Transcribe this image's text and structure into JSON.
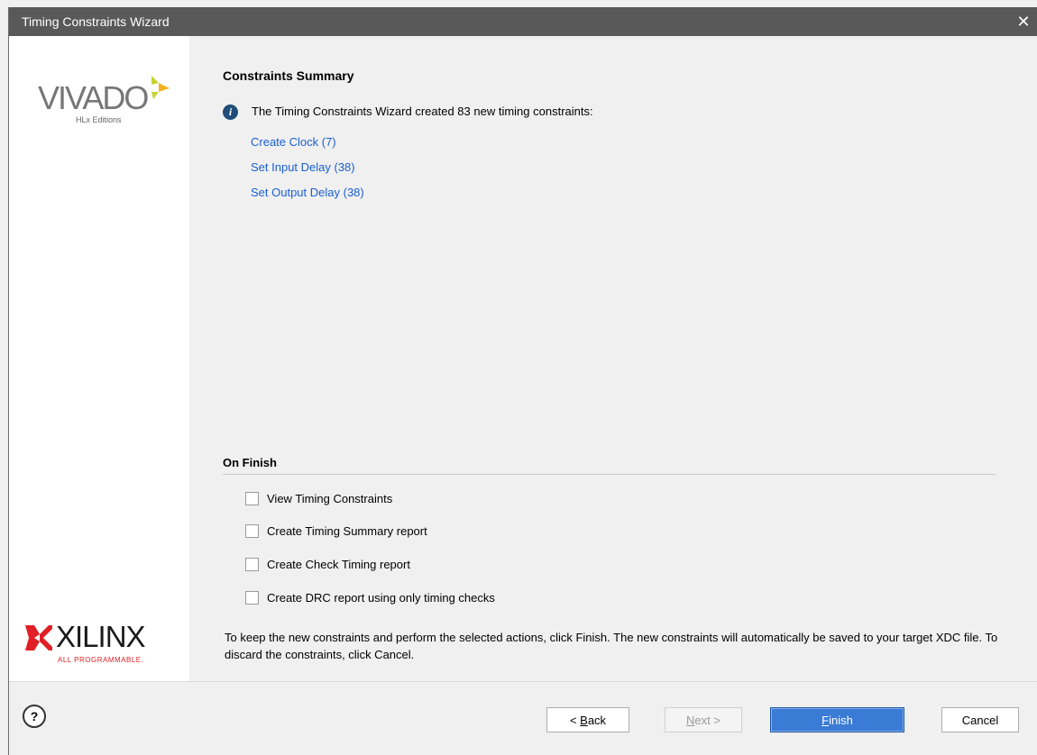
{
  "window": {
    "title": "Timing Constraints Wizard",
    "close_glyph": "✕"
  },
  "sidebar": {
    "vivado_logo": {
      "word": "VIVADO",
      "sub": "HLx Editions"
    },
    "xilinx_logo": {
      "word": "XILINX",
      "sub": "ALL PROGRAMMABLE."
    }
  },
  "main": {
    "heading": "Constraints Summary",
    "info_text": "The Timing Constraints Wizard created 83 new timing constraints:",
    "links": [
      {
        "label": "Create Clock (7)"
      },
      {
        "label": "Set Input Delay (38)"
      },
      {
        "label": "Set Output Delay (38)"
      }
    ],
    "on_finish": {
      "title": "On Finish",
      "options": [
        {
          "label": "View Timing Constraints",
          "checked": false
        },
        {
          "label": "Create Timing Summary report",
          "checked": false
        },
        {
          "label": "Create Check Timing report",
          "checked": false
        },
        {
          "label": "Create DRC report using only timing checks",
          "checked": false
        }
      ]
    },
    "footnote": "To keep the new constraints and perform the selected actions, click Finish. The new constraints will automatically be saved to your target XDC file. To discard the constraints, click Cancel."
  },
  "buttons": {
    "help": "?",
    "back": {
      "prefix": "< ",
      "mnemonic": "B",
      "rest": "ack"
    },
    "next": {
      "mnemonic": "N",
      "rest": "ext >"
    },
    "finish": {
      "mnemonic": "F",
      "rest": "inish"
    },
    "cancel": "Cancel"
  },
  "colors": {
    "titlebar": "#59595a",
    "link": "#1a5fd0",
    "finish": "#3a7bd5",
    "info_icon": "#1f4e79",
    "xilinx_red": "#e01f26",
    "vivado_accent": "#c5d433"
  }
}
